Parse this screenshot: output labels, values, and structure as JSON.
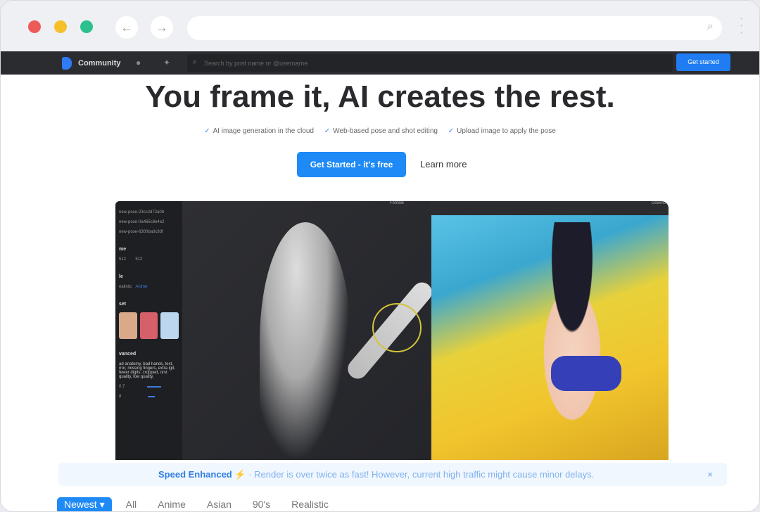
{
  "browser": {
    "back_icon": "←",
    "forward_icon": "→",
    "search_icon": "⌕"
  },
  "nav": {
    "brand": "Community",
    "search_placeholder": "Search by post name or @username",
    "get_started": "Get started"
  },
  "hero": {
    "title": "You frame it, AI creates the rest.",
    "checks": [
      "AI image generation in the cloud",
      "Web-based pose and shot editing",
      "Upload image to apply the pose"
    ],
    "cta": "Get Started - it's free",
    "learn_more": "Learn more"
  },
  "editor": {
    "poses": [
      "new-pose-23cc2d72a08",
      "new-pose-0a465c8e4e2",
      "new-pose-6300ba0c93f"
    ],
    "size_label": "me",
    "width": "512",
    "height": "512",
    "style_label": "le",
    "style_options": [
      "ealistic",
      "Anime"
    ],
    "preset_label": "set",
    "advanced_label": "vanced",
    "negative_prompt": "ad anatomy, bad hands, text, rror, missing fingers, extra igit, fewer digits, cropped, orst quality, low quality,",
    "slider1": "0.7",
    "slider2": "8",
    "model": "Female",
    "download": "Downlo"
  },
  "notice": {
    "title": "Speed Enhanced ⚡",
    "message": "· Render is over twice as fast! However, current high traffic might cause minor delays.",
    "close": "×"
  },
  "tabs": [
    "Newest",
    "All",
    "Anime",
    "Asian",
    "90's",
    "Realistic"
  ],
  "colors": {
    "accent": "#1e8af5",
    "navbar": "#2b2c30"
  }
}
